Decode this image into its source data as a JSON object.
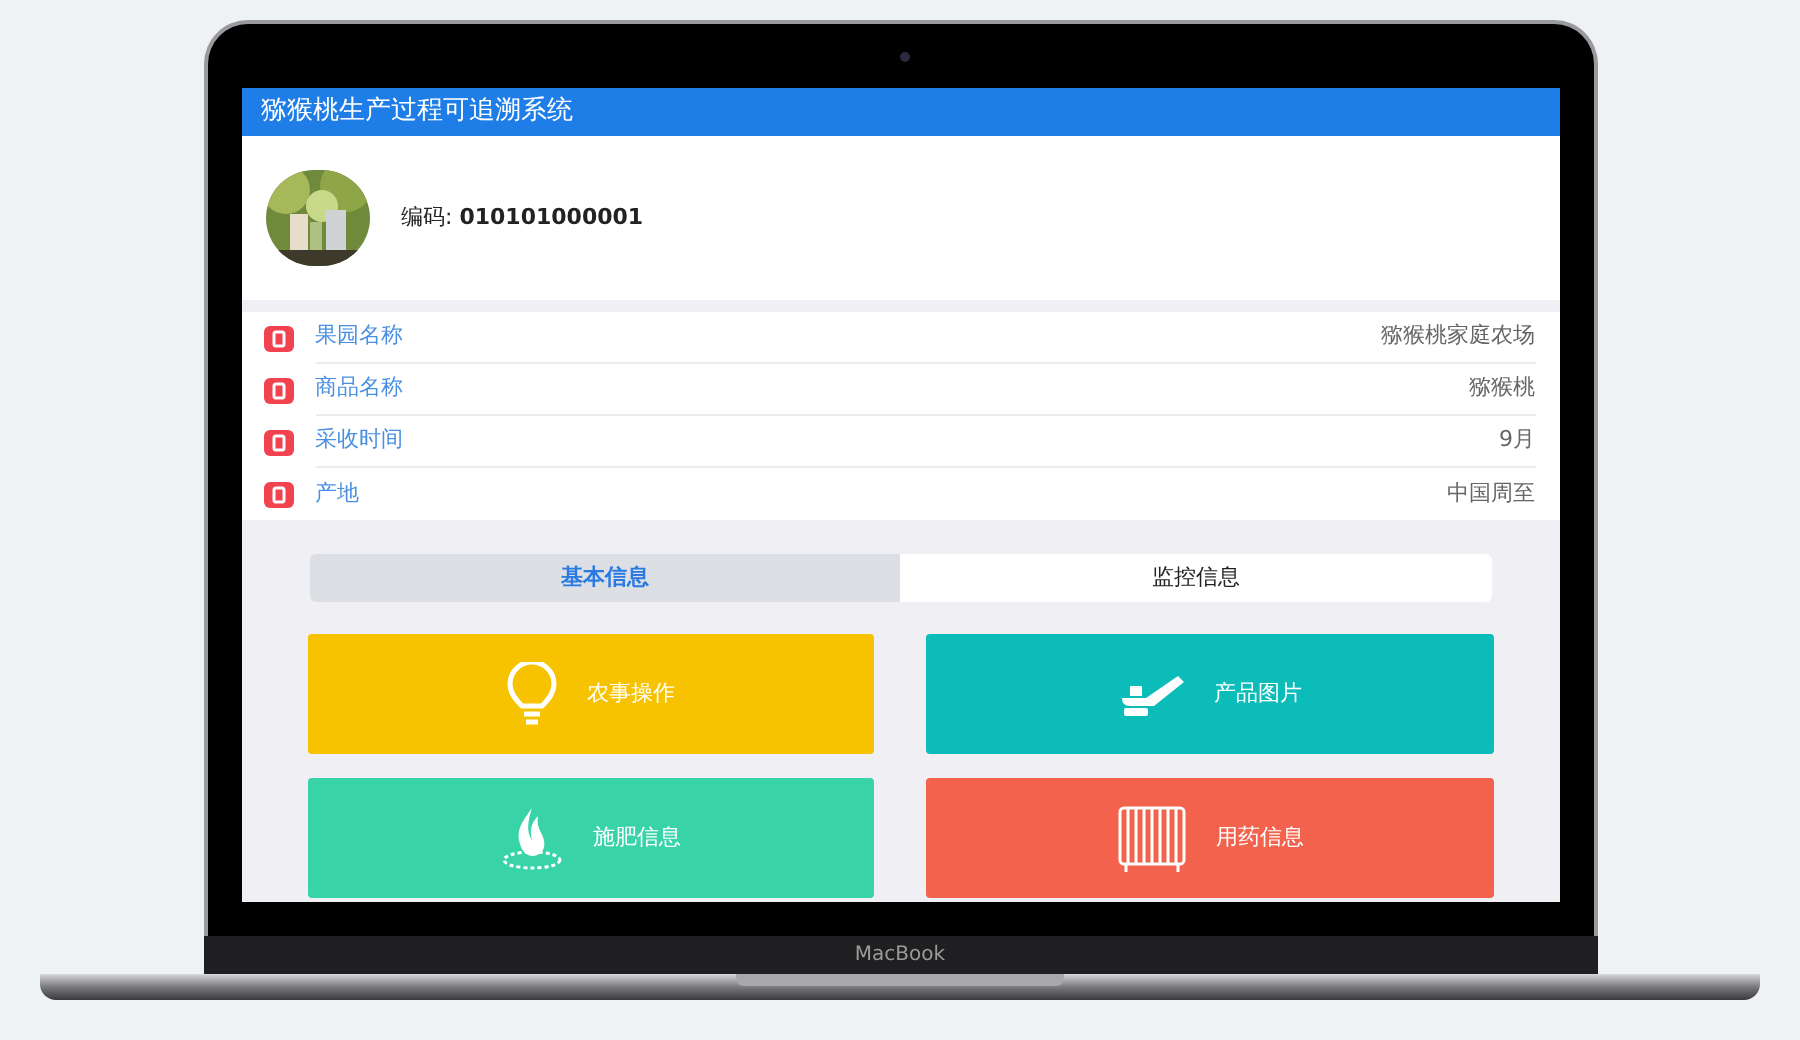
{
  "laptop": {
    "brand": "MacBook"
  },
  "app": {
    "title": "猕猴桃生产过程可追溯系统"
  },
  "profile": {
    "code_label": "编码:",
    "code": "010101000001"
  },
  "info_rows": [
    {
      "label": "果园名称",
      "value": "猕猴桃家庭农场"
    },
    {
      "label": "商品名称",
      "value": "猕猴桃"
    },
    {
      "label": "采收时间",
      "value": "9月"
    },
    {
      "label": "产地",
      "value": "中国周至"
    }
  ],
  "tabs": [
    {
      "label": "基本信息",
      "selected": true
    },
    {
      "label": "监控信息",
      "selected": false
    }
  ],
  "cards": [
    {
      "label": "农事操作",
      "kind": "bulb",
      "color": "#f7c300"
    },
    {
      "label": "产品图片",
      "kind": "sprayer",
      "color": "#0bbcb9"
    },
    {
      "label": "施肥信息",
      "kind": "flame",
      "color": "#38d3a6"
    },
    {
      "label": "用药信息",
      "kind": "radiator",
      "color": "#f2624d"
    }
  ]
}
